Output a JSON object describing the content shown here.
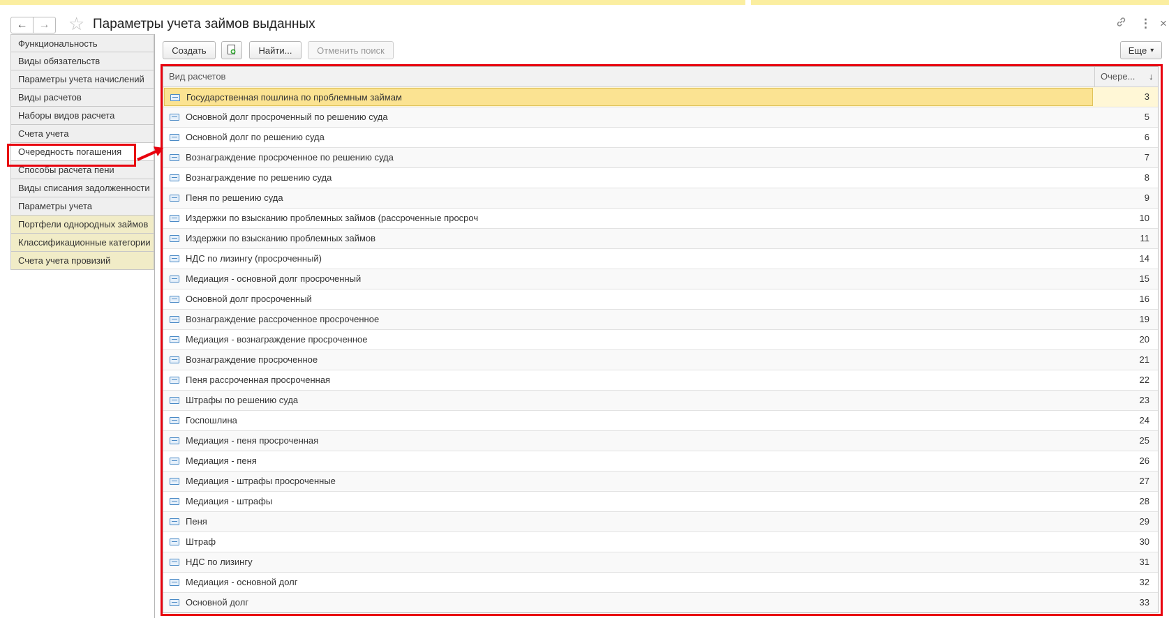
{
  "window": {
    "title": "Параметры учета займов выданных",
    "back_icon": "←",
    "forward_icon": "→",
    "favorite_icon": "☆",
    "link_icon": "🔗",
    "more_icon": "⋮",
    "close_icon": "×"
  },
  "sidebar": {
    "items": [
      {
        "label": "Функциональность"
      },
      {
        "label": "Виды обязательств"
      },
      {
        "label": "Параметры учета начислений"
      },
      {
        "label": "Виды расчетов"
      },
      {
        "label": "Наборы видов расчета"
      },
      {
        "label": "Счета учета"
      },
      {
        "label": "Очередность погашения"
      },
      {
        "label": "Способы расчета пени"
      },
      {
        "label": "Виды списания задолженности"
      },
      {
        "label": "Параметры учета"
      },
      {
        "label": "Портфели однородных займов"
      },
      {
        "label": "Классификационные категории"
      },
      {
        "label": "Счета учета провизий"
      }
    ],
    "active_index": 6
  },
  "toolbar": {
    "create_label": "Создать",
    "find_label": "Найти...",
    "cancel_search_label": "Отменить поиск",
    "more_label": "Еще",
    "more_arrow": "▾"
  },
  "table": {
    "columns": {
      "name": "Вид расчетов",
      "order": "Очере...",
      "sort_icon": "↓"
    },
    "rows": [
      {
        "name": "Государственная пошлина по проблемным займам",
        "order": "3"
      },
      {
        "name": "Основной долг просроченный по решению суда",
        "order": "5"
      },
      {
        "name": "Основной долг по решению суда",
        "order": "6"
      },
      {
        "name": "Вознаграждение просроченное по решению суда",
        "order": "7"
      },
      {
        "name": "Вознаграждение по решению суда",
        "order": "8"
      },
      {
        "name": "Пеня по решению суда",
        "order": "9"
      },
      {
        "name": "Издержки по взысканию проблемных займов (рассроченные просроч",
        "order": "10"
      },
      {
        "name": "Издержки по взысканию проблемных займов",
        "order": "11"
      },
      {
        "name": "НДС по лизингу (просроченный)",
        "order": "14"
      },
      {
        "name": "Медиация - основной долг просроченный",
        "order": "15"
      },
      {
        "name": "Основной долг просроченный",
        "order": "16"
      },
      {
        "name": "Вознаграждение рассроченное просроченное",
        "order": "19"
      },
      {
        "name": "Медиация - вознаграждение просроченное",
        "order": "20"
      },
      {
        "name": "Вознаграждение просроченное",
        "order": "21"
      },
      {
        "name": "Пеня рассроченная просроченная",
        "order": "22"
      },
      {
        "name": "Штрафы по решению суда",
        "order": "23"
      },
      {
        "name": "Госпошлина",
        "order": "24"
      },
      {
        "name": "Медиация - пеня просроченная",
        "order": "25"
      },
      {
        "name": "Медиация - пеня",
        "order": "26"
      },
      {
        "name": "Медиация - штрафы просроченные",
        "order": "27"
      },
      {
        "name": "Медиация - штрафы",
        "order": "28"
      },
      {
        "name": "Пеня",
        "order": "29"
      },
      {
        "name": "Штраф",
        "order": "30"
      },
      {
        "name": "НДС по лизингу",
        "order": "31"
      },
      {
        "name": "Медиация - основной долг",
        "order": "32"
      },
      {
        "name": "Основной долг",
        "order": "33"
      }
    ],
    "selected_index": 0
  },
  "colors": {
    "highlight": "#e8000d",
    "selected_row": "#fbe392",
    "extension_item": "#f1ecc7"
  }
}
